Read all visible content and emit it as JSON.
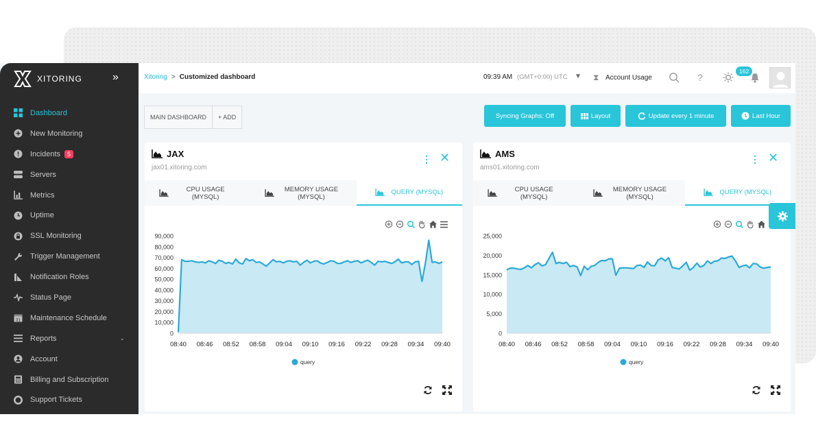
{
  "brand": {
    "name": "XITORING"
  },
  "sidebar": {
    "items": [
      {
        "label": "Dashboard",
        "icon": "dashboard-icon",
        "active": true
      },
      {
        "label": "New Monitoring",
        "icon": "plus-icon"
      },
      {
        "label": "Incidents",
        "icon": "alert-icon",
        "badge": "5"
      },
      {
        "label": "Servers",
        "icon": "server-icon"
      },
      {
        "label": "Metrics",
        "icon": "metrics-icon"
      },
      {
        "label": "Uptime",
        "icon": "uptime-icon"
      },
      {
        "label": "SSL Monitoring",
        "icon": "lock-icon"
      },
      {
        "label": "Trigger Management",
        "icon": "wrench-icon"
      },
      {
        "label": "Notification Roles",
        "icon": "notification-icon"
      },
      {
        "label": "Status Page",
        "icon": "pulse-icon"
      },
      {
        "label": "Maintenance Schedule",
        "icon": "calendar-icon"
      },
      {
        "label": "Reports",
        "icon": "reports-icon",
        "expandable": true
      },
      {
        "label": "Account",
        "icon": "user-icon"
      },
      {
        "label": "Billing and Subscription",
        "icon": "billing-icon"
      },
      {
        "label": "Support Tickets",
        "icon": "lifebuoy-icon"
      }
    ]
  },
  "topbar": {
    "breadcrumb_root": "Xitoring",
    "breadcrumb_sep": ">",
    "breadcrumb_current": "Customized dashboard",
    "time": "09:39 AM",
    "timezone": "(GMT+0:00) UTC",
    "tz_arrow": "▼",
    "account_label": "Account Usage",
    "help": "?",
    "notification_count": "162"
  },
  "dashboard_tabs": [
    "MAIN DASHBOARD",
    "+ ADD"
  ],
  "toolbar": {
    "sync": "Syncing Graphs: Off",
    "layout": "Layout",
    "update": "Update every 1 minute",
    "range": "Last Hour"
  },
  "accent_color": "#29c5d9",
  "panels": [
    {
      "title": "JAX",
      "host": "jax01.xitoring.com",
      "tabs": [
        "CPU USAGE (MYSQL)",
        "MEMORY USAGE (MYSQL)",
        "QUERY (MYSQL)"
      ],
      "active_tab": 2,
      "legend": "query"
    },
    {
      "title": "AMS",
      "host": "ams01.xitoring.com",
      "tabs": [
        "CPU USAGE (MYSQL)",
        "MEMORY USAGE (MYSQL)",
        "QUERY (MYSQL)"
      ],
      "active_tab": 2,
      "legend": "query"
    }
  ],
  "chart_data": [
    {
      "type": "area",
      "series": [
        {
          "name": "query",
          "values": [
            1000,
            68000,
            66500,
            66500,
            67000,
            66000,
            65500,
            66000,
            65000,
            67000,
            66000,
            64500,
            67500,
            66500,
            64500,
            65500,
            64000,
            68500,
            65000,
            64000,
            69000,
            67000,
            68000,
            65500,
            66000,
            64000,
            62000,
            65000,
            68000,
            66000,
            66500,
            65000,
            66500,
            67000,
            66000,
            66500,
            63000,
            65500,
            67500,
            65000,
            66500,
            67000,
            65000,
            64000,
            65500,
            67000,
            66500,
            64500,
            64500,
            66000,
            67000,
            65500,
            66500,
            67000,
            65000,
            66500,
            67500,
            65500,
            63000,
            66500,
            66000,
            66500,
            65500,
            64500,
            66000,
            68500,
            65000,
            66000,
            66000,
            63500,
            66000,
            66500,
            48000,
            64500,
            86000,
            65500,
            66000,
            64500,
            66000
          ]
        }
      ],
      "x_ticks": [
        "08:40",
        "08:46",
        "08:52",
        "08:58",
        "09:04",
        "09:10",
        "09:16",
        "09:22",
        "09:28",
        "09:34",
        "09:40"
      ],
      "y_ticks": [
        "0",
        "10,000",
        "20,000",
        "30,000",
        "40,000",
        "50,000",
        "60,000",
        "70,000",
        "80,000",
        "90,000"
      ],
      "ylim": [
        0,
        90000
      ],
      "legend_position": "bottom"
    },
    {
      "type": "area",
      "series": [
        {
          "name": "query",
          "values": [
            16300,
            16700,
            16700,
            16500,
            16400,
            16800,
            17400,
            16800,
            17600,
            18100,
            17300,
            17600,
            19200,
            20800,
            17900,
            18200,
            17900,
            18200,
            17100,
            17400,
            17000,
            14800,
            17200,
            16300,
            17200,
            17400,
            18200,
            18700,
            18600,
            19100,
            19100,
            14900,
            16700,
            16800,
            16800,
            16700,
            16600,
            17400,
            17500,
            16900,
            18300,
            17400,
            17300,
            18800,
            19300,
            18600,
            19400,
            16900,
            16700,
            16500,
            17300,
            18200,
            16200,
            16900,
            18000,
            17000,
            17400,
            18600,
            17900,
            18500,
            18600,
            19300,
            19200,
            19600,
            19800,
            18500,
            16900,
            17300,
            17500,
            16800,
            17900,
            17800,
            17000,
            16700,
            16900,
            17000
          ]
        }
      ],
      "x_ticks": [
        "08:40",
        "08:46",
        "08:52",
        "08:58",
        "09:04",
        "09:10",
        "09:16",
        "09:22",
        "09:28",
        "09:34",
        "09:40"
      ],
      "y_ticks": [
        "0",
        "5,000",
        "10,000",
        "15,000",
        "20,000",
        "25,000"
      ],
      "ylim": [
        0,
        25000
      ],
      "legend_position": "bottom"
    }
  ]
}
